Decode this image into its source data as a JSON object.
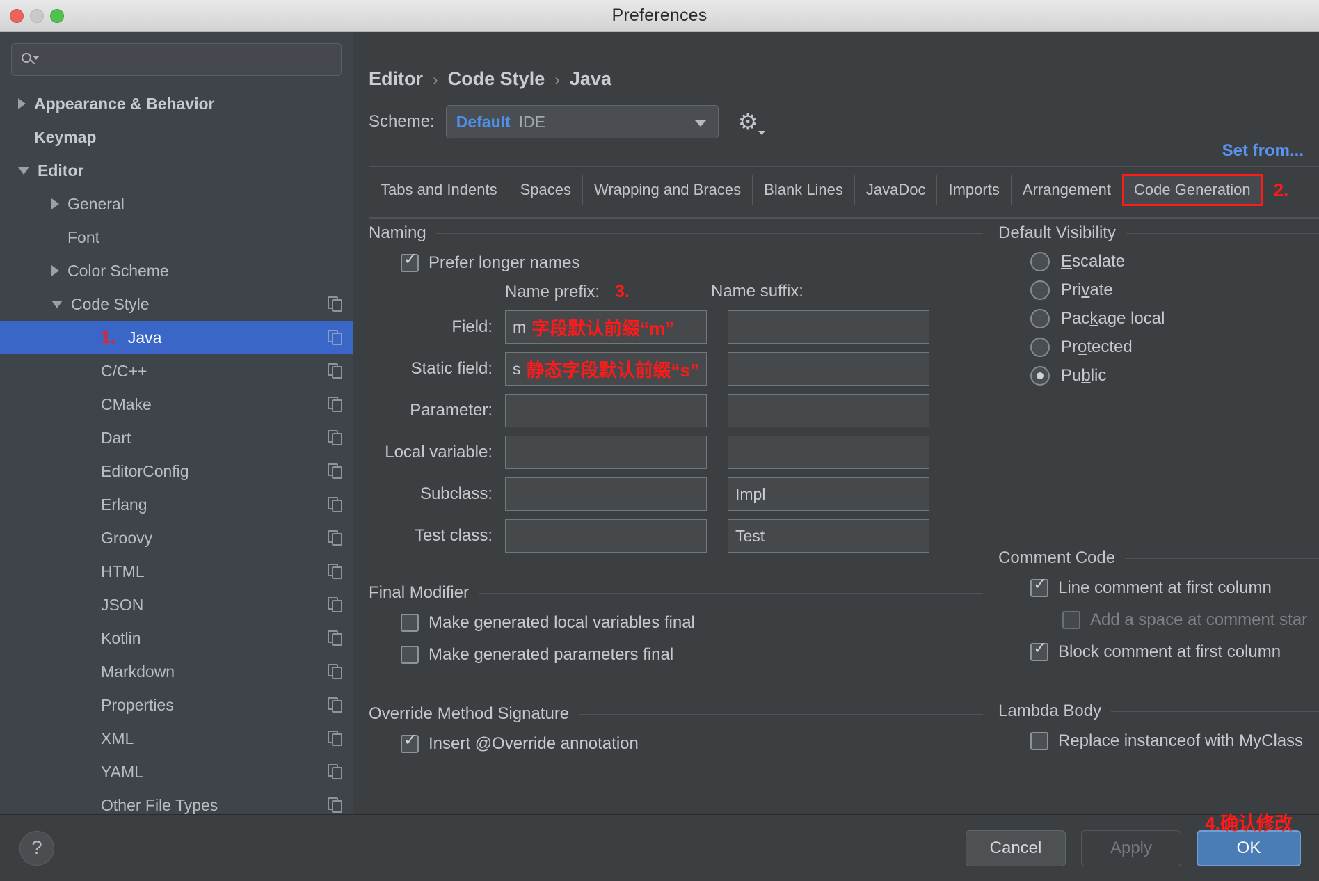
{
  "window": {
    "title": "Preferences"
  },
  "sidebar": {
    "search": {
      "placeholder": "",
      "value": "",
      "icon": "search-icon"
    },
    "items": [
      {
        "label": "Appearance & Behavior",
        "twisty": "collapsed",
        "indent": 0,
        "bold": true,
        "copy": false,
        "selected": false
      },
      {
        "label": "Keymap",
        "twisty": "none",
        "indent": 0,
        "bold": true,
        "copy": false,
        "selected": false
      },
      {
        "label": "Editor",
        "twisty": "expanded",
        "indent": 0,
        "bold": true,
        "copy": false,
        "selected": false
      },
      {
        "label": "General",
        "twisty": "collapsed",
        "indent": 1,
        "bold": false,
        "copy": false,
        "selected": false
      },
      {
        "label": "Font",
        "twisty": "none",
        "indent": 1,
        "bold": false,
        "copy": false,
        "selected": false
      },
      {
        "label": "Color Scheme",
        "twisty": "collapsed",
        "indent": 1,
        "bold": false,
        "copy": false,
        "selected": false
      },
      {
        "label": "Code Style",
        "twisty": "expanded",
        "indent": 1,
        "bold": false,
        "copy": true,
        "selected": false
      },
      {
        "label": "Java",
        "twisty": "none",
        "indent": 2,
        "bold": false,
        "copy": true,
        "selected": true,
        "note": "1."
      },
      {
        "label": "C/C++",
        "twisty": "none",
        "indent": 2,
        "bold": false,
        "copy": true,
        "selected": false
      },
      {
        "label": "CMake",
        "twisty": "none",
        "indent": 2,
        "bold": false,
        "copy": true,
        "selected": false
      },
      {
        "label": "Dart",
        "twisty": "none",
        "indent": 2,
        "bold": false,
        "copy": true,
        "selected": false
      },
      {
        "label": "EditorConfig",
        "twisty": "none",
        "indent": 2,
        "bold": false,
        "copy": true,
        "selected": false
      },
      {
        "label": "Erlang",
        "twisty": "none",
        "indent": 2,
        "bold": false,
        "copy": true,
        "selected": false
      },
      {
        "label": "Groovy",
        "twisty": "none",
        "indent": 2,
        "bold": false,
        "copy": true,
        "selected": false
      },
      {
        "label": "HTML",
        "twisty": "none",
        "indent": 2,
        "bold": false,
        "copy": true,
        "selected": false
      },
      {
        "label": "JSON",
        "twisty": "none",
        "indent": 2,
        "bold": false,
        "copy": true,
        "selected": false
      },
      {
        "label": "Kotlin",
        "twisty": "none",
        "indent": 2,
        "bold": false,
        "copy": true,
        "selected": false
      },
      {
        "label": "Markdown",
        "twisty": "none",
        "indent": 2,
        "bold": false,
        "copy": true,
        "selected": false
      },
      {
        "label": "Properties",
        "twisty": "none",
        "indent": 2,
        "bold": false,
        "copy": true,
        "selected": false
      },
      {
        "label": "XML",
        "twisty": "none",
        "indent": 2,
        "bold": false,
        "copy": true,
        "selected": false
      },
      {
        "label": "YAML",
        "twisty": "none",
        "indent": 2,
        "bold": false,
        "copy": true,
        "selected": false
      },
      {
        "label": "Other File Types",
        "twisty": "none",
        "indent": 2,
        "bold": false,
        "copy": true,
        "selected": false
      }
    ],
    "help_label": "?"
  },
  "header": {
    "breadcrumb": [
      "Editor",
      "Code Style",
      "Java"
    ],
    "separator": "›",
    "scheme_label": "Scheme:",
    "scheme_value": "Default",
    "scheme_sub": "IDE",
    "gear": "gear-icon",
    "set_from": "Set from..."
  },
  "tabs": {
    "items": [
      {
        "label": "Tabs and Indents",
        "active": false
      },
      {
        "label": "Spaces",
        "active": false
      },
      {
        "label": "Wrapping and Braces",
        "active": false
      },
      {
        "label": "Blank Lines",
        "active": false
      },
      {
        "label": "JavaDoc",
        "active": false
      },
      {
        "label": "Imports",
        "active": false
      },
      {
        "label": "Arrangement",
        "active": false
      },
      {
        "label": "Code Generation",
        "active": true
      }
    ],
    "note": "2."
  },
  "naming": {
    "title": "Naming",
    "prefer_longer_names": {
      "label": "Prefer longer names",
      "checked": true
    },
    "col_prefix_label": "Name prefix:",
    "col_prefix_note": "3.",
    "col_suffix_label": "Name suffix:",
    "rows": [
      {
        "label": "Field:",
        "prefix": "m",
        "prefix_note": "字段默认前缀“m”",
        "suffix": ""
      },
      {
        "label": "Static field:",
        "prefix": "s",
        "prefix_note": "静态字段默认前缀“s”",
        "suffix": ""
      },
      {
        "label": "Parameter:",
        "prefix": "",
        "prefix_note": "",
        "suffix": ""
      },
      {
        "label": "Local variable:",
        "prefix": "",
        "prefix_note": "",
        "suffix": ""
      },
      {
        "label": "Subclass:",
        "prefix": "",
        "prefix_note": "",
        "suffix": "Impl"
      },
      {
        "label": "Test class:",
        "prefix": "",
        "prefix_note": "",
        "suffix": "Test"
      }
    ]
  },
  "default_visibility": {
    "title": "Default Visibility",
    "options": [
      {
        "label": "Escalate",
        "mnemonic": "E",
        "selected": false
      },
      {
        "label": "Private",
        "mnemonic": "v",
        "selected": false
      },
      {
        "label": "Package local",
        "mnemonic": "k",
        "selected": false
      },
      {
        "label": "Protected",
        "mnemonic": "o",
        "selected": false
      },
      {
        "label": "Public",
        "mnemonic": "b",
        "selected": true
      }
    ]
  },
  "final_modifier": {
    "title": "Final Modifier",
    "items": [
      {
        "label": "Make generated local variables final",
        "checked": false,
        "dim": false
      },
      {
        "label": "Make generated parameters final",
        "checked": false,
        "dim": false
      }
    ]
  },
  "comment_code": {
    "title": "Comment Code",
    "items": [
      {
        "label": "Line comment at first column",
        "checked": true,
        "dim": false,
        "indent": 1
      },
      {
        "label": "Add a space at comment star",
        "checked": false,
        "dim": true,
        "indent": 2
      },
      {
        "label": "Block comment at first column",
        "checked": true,
        "dim": false,
        "indent": 1
      }
    ]
  },
  "override_method_signature": {
    "title": "Override Method Signature",
    "items": [
      {
        "label": "Insert @Override annotation",
        "checked": true,
        "dim": false
      }
    ]
  },
  "lambda_body": {
    "title": "Lambda Body",
    "items": [
      {
        "label": "Replace instanceof with MyClass",
        "checked": false,
        "dim": false
      }
    ]
  },
  "footer": {
    "cancel": "Cancel",
    "apply": "Apply",
    "ok": "OK",
    "ok_note": "4.确认修改"
  },
  "colors": {
    "accent_blue": "#4d90ea",
    "selection_blue": "#3a66c8",
    "ok_button": "#4a7cb5",
    "annotation_red": "#ff1a1a",
    "panel_bg": "#3c3f41",
    "sidebar_bg": "#3f434a"
  }
}
